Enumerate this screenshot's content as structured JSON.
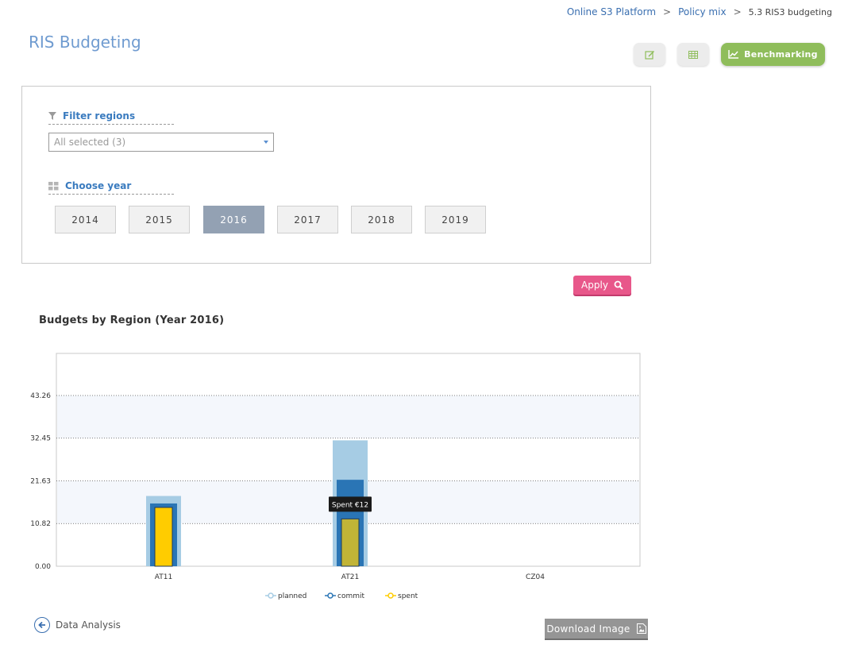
{
  "breadcrumb": {
    "items": [
      "Online S3 Platform",
      "Policy mix"
    ],
    "separator": ">",
    "current": "5.3 RIS3 budgeting"
  },
  "page": {
    "title": "RIS Budgeting"
  },
  "toolbar": {
    "edit_icon": "pencil-square-icon",
    "table_icon": "table-grid-icon",
    "benchmarking_label": "Benchmarking",
    "benchmarking_color": "#8fbd5b"
  },
  "filters": {
    "regions_label": "Filter regions",
    "regions_value": "All selected (3)",
    "year_label": "Choose year",
    "years": [
      "2014",
      "2015",
      "2016",
      "2017",
      "2018",
      "2019"
    ],
    "selected_year": "2016"
  },
  "apply": {
    "label": "Apply",
    "color": "#e8578a"
  },
  "chart_title": "Budgets by Region (Year 2016)",
  "chart_data": {
    "type": "bar",
    "categories": [
      "AT11",
      "AT21",
      "CZ04"
    ],
    "series": [
      {
        "name": "planned",
        "values": [
          17.8,
          31.9,
          null
        ],
        "color": "#a6cce4"
      },
      {
        "name": "commit",
        "values": [
          15.9,
          21.9,
          null
        ],
        "color": "#2a75b5"
      },
      {
        "name": "spent",
        "values": [
          14.9,
          12.0,
          null
        ],
        "color": "#ffcc00"
      }
    ],
    "y_ticks": [
      "0.00",
      "10.82",
      "21.63",
      "32.45",
      "43.26"
    ],
    "ylim": [
      0,
      43.26
    ],
    "grid": true,
    "legend_position": "bottom",
    "tooltip": {
      "text": "Spent €12",
      "category": "AT21"
    }
  },
  "footer": {
    "back_label": "Data Analysis",
    "download_label": "Download Image"
  }
}
